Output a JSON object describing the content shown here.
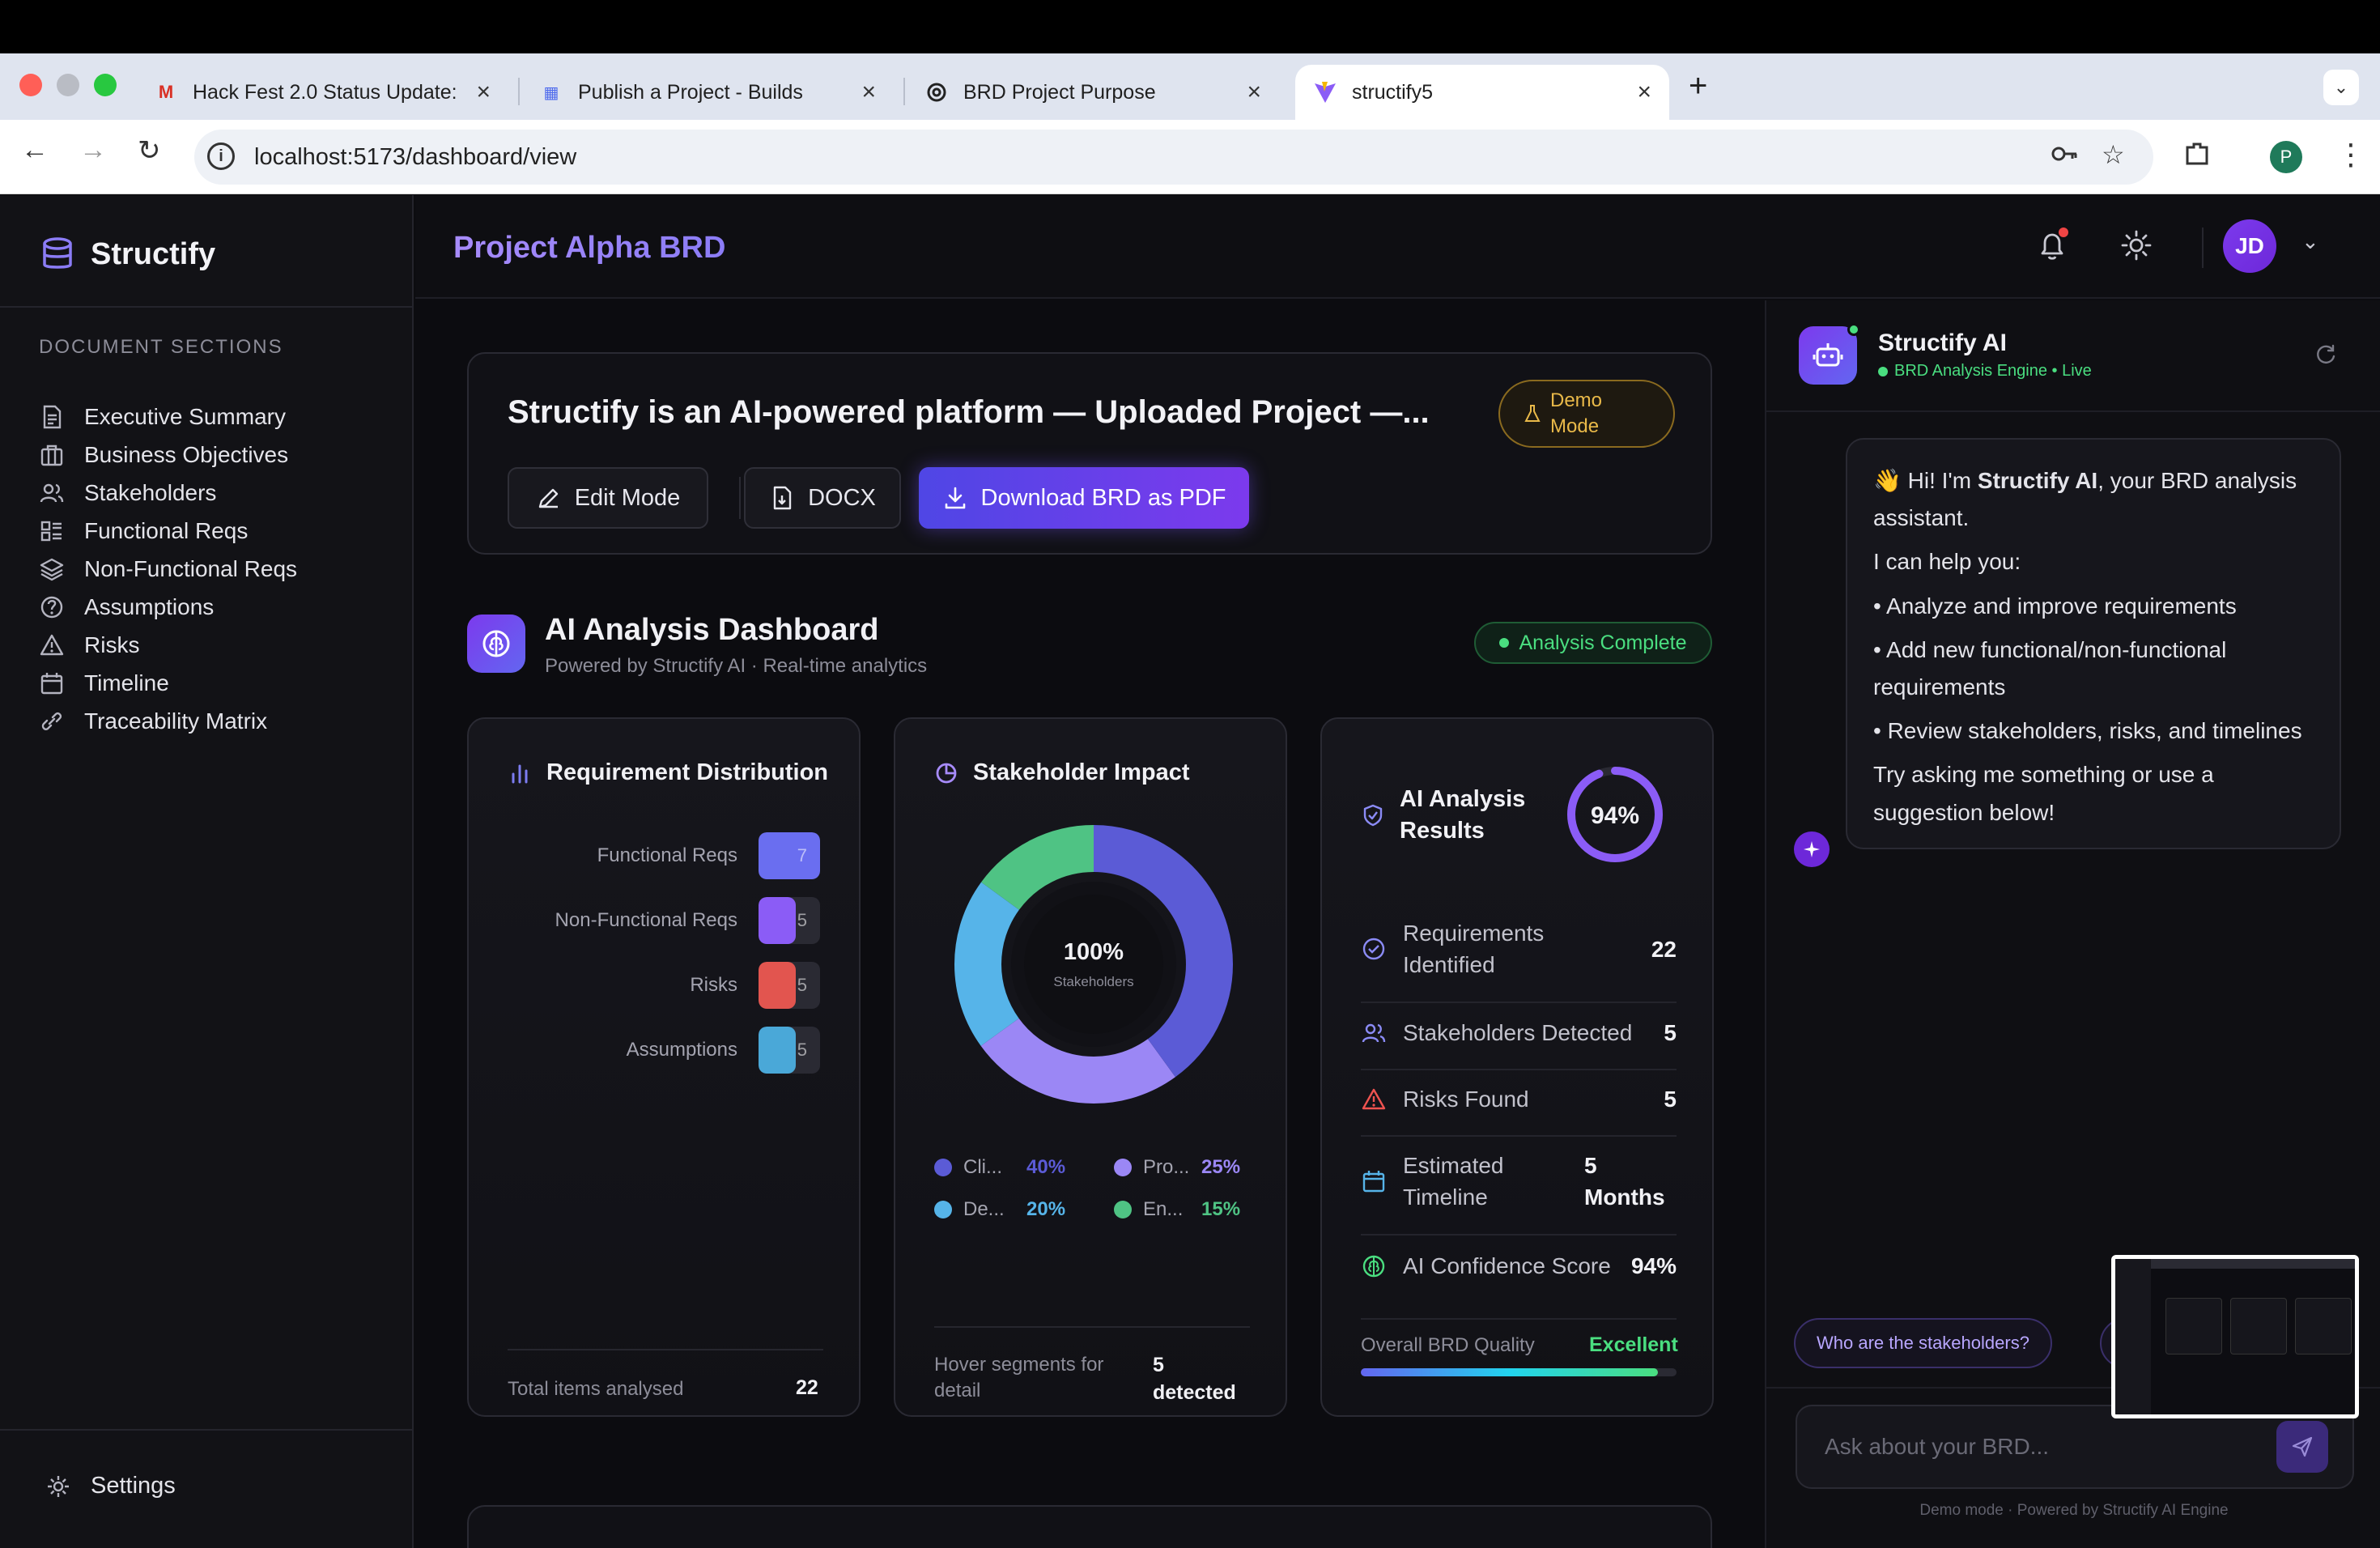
{
  "browser": {
    "tabs": [
      {
        "title": "Hack Fest 2.0 Status Update: ",
        "favicon": "gmail-icon"
      },
      {
        "title": "Publish a Project - Builds",
        "favicon": "builds-icon"
      },
      {
        "title": "BRD Project Purpose",
        "favicon": "openai-icon"
      },
      {
        "title": "structify5",
        "favicon": "vite-icon"
      }
    ],
    "active_tab": 3,
    "url": "localhost:5173/dashboard/view",
    "profile_initial": "P"
  },
  "app": {
    "brand": "Structify",
    "page_title": "Project Alpha BRD",
    "user_initials": "JD"
  },
  "sidebar": {
    "heading": "DOCUMENT SECTIONS",
    "items": [
      {
        "label": "Executive Summary",
        "icon": "document-icon"
      },
      {
        "label": "Business Objectives",
        "icon": "briefcase-icon"
      },
      {
        "label": "Stakeholders",
        "icon": "users-icon"
      },
      {
        "label": "Functional Reqs",
        "icon": "list-icon"
      },
      {
        "label": "Non-Functional Reqs",
        "icon": "layers-icon"
      },
      {
        "label": "Assumptions",
        "icon": "question-circle-icon"
      },
      {
        "label": "Risks",
        "icon": "warning-icon"
      },
      {
        "label": "Timeline",
        "icon": "calendar-icon"
      },
      {
        "label": "Traceability Matrix",
        "icon": "link-icon"
      }
    ],
    "settings_label": "Settings"
  },
  "project": {
    "title": "Structify is an AI-powered platform — Uploaded Project —...",
    "demo_badge_line1": "Demo",
    "demo_badge_line2": "Mode",
    "edit_label": "Edit Mode",
    "docx_label": "DOCX",
    "download_label": "Download BRD as PDF"
  },
  "dashboard": {
    "title": "AI Analysis Dashboard",
    "subtitle": "Powered by Structify AI · Real-time analytics",
    "status": "Analysis Complete"
  },
  "requirement_distribution": {
    "title": "Requirement Distribution",
    "rows": [
      {
        "label": "Functional Reqs",
        "value": "7",
        "fill": 1.0,
        "color": "#6a6ef0"
      },
      {
        "label": "Non-Functional Reqs",
        "value": "5",
        "fill": 0.6,
        "color": "#8b5cf6"
      },
      {
        "label": "Risks",
        "value": "5",
        "fill": 0.6,
        "color": "#e2554f"
      },
      {
        "label": "Assumptions",
        "value": "5",
        "fill": 0.6,
        "color": "#4aa8d8"
      }
    ],
    "footer_label": "Total items analysed",
    "footer_value": "22"
  },
  "stakeholder_impact": {
    "title": "Stakeholder Impact",
    "center_value": "100%",
    "center_label": "Stakeholders",
    "segments": [
      {
        "label": "Cli...",
        "pct": "40%",
        "value": 40,
        "color": "#5b5bd6"
      },
      {
        "label": "Pro...",
        "pct": "25%",
        "value": 25,
        "color": "#9b87f5"
      },
      {
        "label": "De...",
        "pct": "20%",
        "value": 20,
        "color": "#56b4e9"
      },
      {
        "label": "En...",
        "pct": "15%",
        "value": 15,
        "color": "#4fc384"
      }
    ],
    "footer_label_1": "Hover segments for",
    "footer_label_2": "detail",
    "footer_value_1": "5",
    "footer_value_2": "detected"
  },
  "ai_results": {
    "title_line1": "AI Analysis",
    "title_line2": "Results",
    "score": "94%",
    "score_value": 0.94,
    "rows": [
      {
        "label_line1": "Requirements",
        "label_line2": "Identified",
        "value": "22",
        "icon": "check-circle-icon"
      },
      {
        "label_line1": "Stakeholders Detected",
        "label_line2": "",
        "value": "5",
        "icon": "users-icon"
      },
      {
        "label_line1": "Risks Found",
        "label_line2": "",
        "value": "5",
        "icon": "warning-icon"
      },
      {
        "label_line1": "Estimated",
        "label_line2": "Timeline",
        "value": "5",
        "value_line2": "Months",
        "icon": "calendar-icon"
      },
      {
        "label_line1": "AI Confidence Score",
        "label_line2": "",
        "value": "94%",
        "icon": "brain-icon"
      }
    ],
    "quality_label": "Overall BRD Quality",
    "quality_value": "Excellent",
    "quality_fill": 0.94
  },
  "ai_panel": {
    "name": "Structify AI",
    "status": "BRD Analysis Engine • Live",
    "greeting_prefix": "Hi! I'm ",
    "greeting_name": "Structify AI",
    "greeting_suffix": ", your BRD analysis assistant.",
    "intro": "I can help you:",
    "bullets": [
      "• Analyze and improve requirements",
      "• Add new functional/non-functional requirements",
      "• Review stakeholders, risks, and timelines"
    ],
    "closing": "Try asking me something or use a suggestion below!",
    "suggestions": [
      "Who are the stakeholders?",
      "A"
    ],
    "input_placeholder": "Ask about your BRD...",
    "footer": "Demo mode · Powered by Structify AI Engine"
  }
}
